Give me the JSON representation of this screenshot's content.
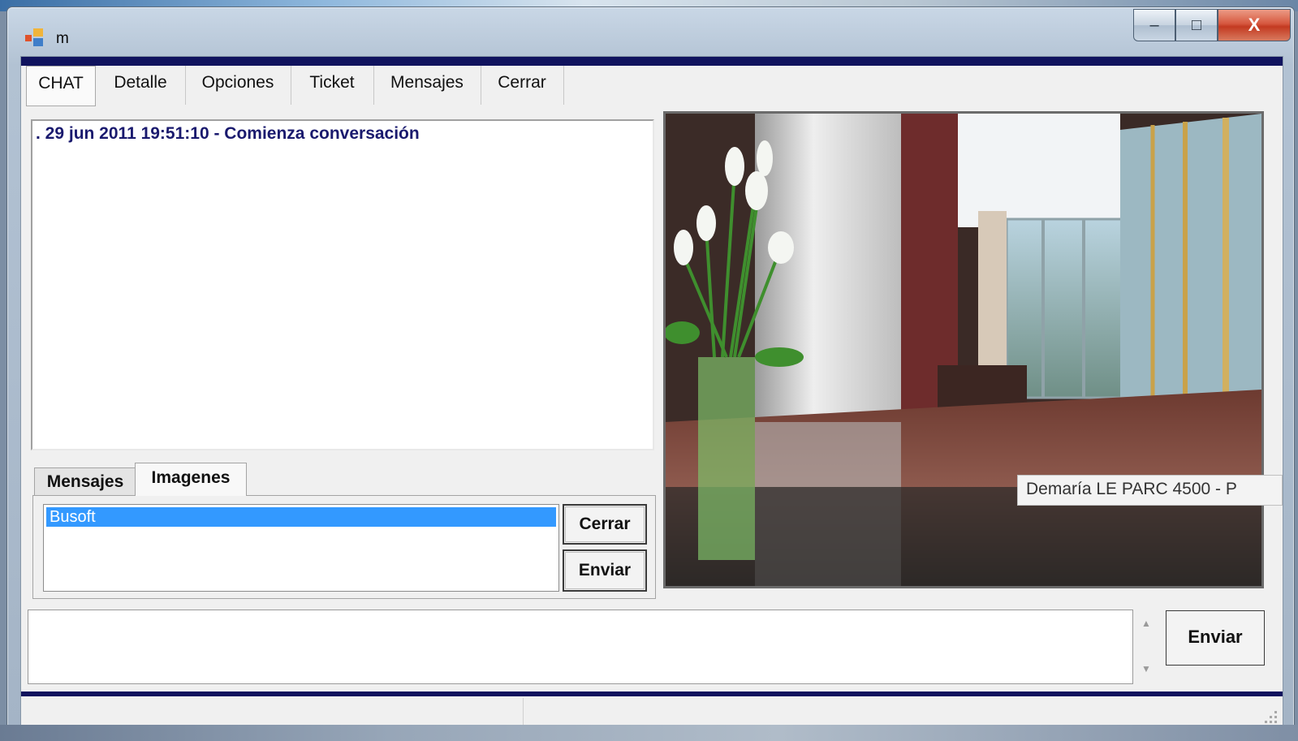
{
  "window": {
    "title": "m",
    "controls": {
      "minimize": "–",
      "maximize": "□",
      "close": "X"
    }
  },
  "menu": {
    "items": [
      "CHAT",
      "Detalle",
      "Opciones",
      "Ticket",
      "Mensajes",
      "Cerrar"
    ]
  },
  "chat": {
    "log_line": ". 29 jun 2011 19:51:10 - Comienza conversación"
  },
  "subtabs": {
    "mensajes": "Mensajes",
    "imagenes": "Imagenes"
  },
  "images_panel": {
    "list_items": [
      "Busoft"
    ],
    "cerrar_button": "Cerrar",
    "enviar_button": "Enviar"
  },
  "photo": {
    "tooltip": "Demaría LE PARC 4500 - P"
  },
  "compose": {
    "send_button": "Enviar",
    "input_value": ""
  },
  "colors": {
    "accent_bar": "#10135e",
    "selection": "#3399ff",
    "chat_text": "#1a1a6e"
  }
}
